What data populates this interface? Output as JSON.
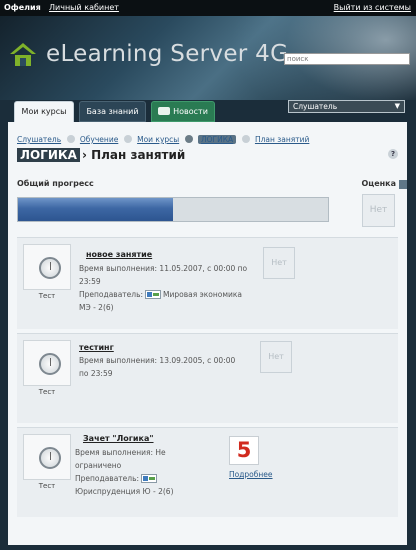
{
  "topbar": {
    "user": "Офелия",
    "cabinet": "Личный кабинет",
    "logout": "Выйти из системы"
  },
  "header": {
    "logo_text": "eLearning Server 4G",
    "search_placeholder": "поиск"
  },
  "tabs": [
    {
      "label": "Мои курсы",
      "active": true
    },
    {
      "label": "База знаний",
      "active": false
    },
    {
      "label": "Новости",
      "active": false
    }
  ],
  "role_select": {
    "value": "Слушатель",
    "arrow": "▼"
  },
  "breadcrumb": [
    "Слушатель",
    "Обучение",
    "Мои курсы",
    "ЛОГИКА",
    "План занятий"
  ],
  "title": {
    "badge": "ЛОГИКА",
    "rest": "› План занятий"
  },
  "help_label": "?",
  "progress": {
    "label": "Общий прогресс",
    "value": 0.5
  },
  "grade": {
    "label": "Оценка",
    "value": "Нет"
  },
  "items": [
    {
      "type": "Тест",
      "name": "новое занятие",
      "time_label": "Время выполнения: 11.05.2007, с 00:00 по 23:59",
      "time_line1": "Время выполнения: 11.05.2007, с 00:00 по",
      "time_line2": "23:59",
      "teacher_label": "Преподаватель:",
      "teacher_name": "Мировая экономика",
      "group": "МЭ - 2(6)",
      "grade": "Нет"
    },
    {
      "type": "Тест",
      "name": "тестинг",
      "time_line1": "Время выполнения: 13.09.2005, с 00:00",
      "time_line2": "по 23:59",
      "grade": "Нет"
    },
    {
      "type": "Тест",
      "name": "Зачет \"Логика\"",
      "time_line1": "Время выполнения: Не",
      "time_line2": "ограничено",
      "teacher_label": "Преподаватель:",
      "teacher_name": "Юриспруденция Ю - 2(6)",
      "grade": "5",
      "more": "Подробнее"
    }
  ],
  "colors": {
    "accent_progress": "#3d67a4",
    "grade_red": "#d12a1e",
    "news_tab": "#2a7b53",
    "logo_green": "#7fb22a"
  },
  "icons": [
    "house-logo-icon",
    "stopwatch-icon",
    "teacher-card-icon",
    "news-icon",
    "help-icon",
    "chevron-down-icon"
  ]
}
